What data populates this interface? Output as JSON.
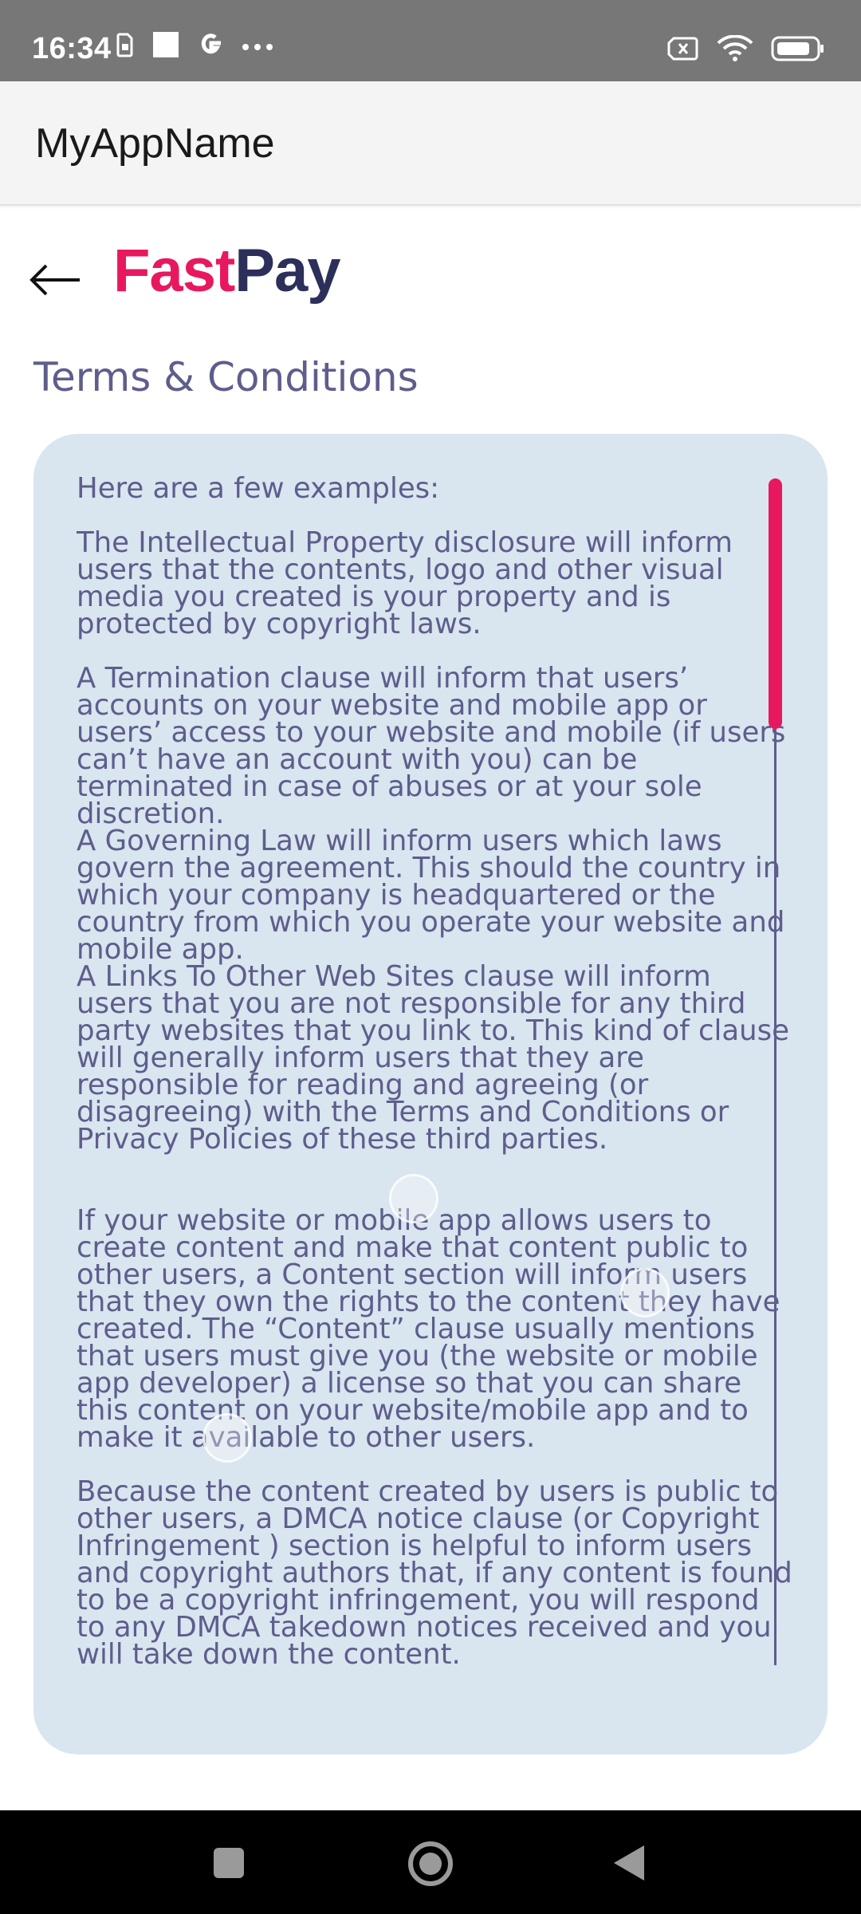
{
  "status_bar": {
    "time": "16:34",
    "left_icons": [
      "sim-icon",
      "notification-square-icon",
      "google-icon",
      "more-dots-icon"
    ],
    "right_icons": [
      "no-sim-icon",
      "wifi-icon",
      "battery-icon"
    ]
  },
  "app_bar": {
    "title": "MyAppName"
  },
  "header": {
    "back_icon": "arrow-left-icon",
    "logo_part1": "Fast",
    "logo_part2": "Pay",
    "logo_colors": {
      "fast": "#e8185f",
      "pay": "#2c2f5a"
    }
  },
  "page": {
    "title": "Terms & Conditions"
  },
  "terms": {
    "intro": "Here are a few examples:",
    "paragraphs": [
      "The Intellectual Property disclosure will inform users that the contents, logo and other visual media you created is your property and is protected by copyright laws.",
      "A Termination clause will inform that users’ accounts on your website and mobile app or users’ access to your website and mobile (if users can’t have an account with you) can be terminated in case of abuses or at your sole discretion.",
      "A Governing Law will inform users which laws govern the agreement. This should the country in which your company is headquartered or the country from which you operate your website and mobile app.",
      "A Links To Other Web Sites clause will inform users that you are not responsible for any third party websites that you link to. This kind of clause will generally inform users that they are responsible for reading and agreeing (or disagreeing) with the Terms and Conditions or Privacy Policies of these third parties.",
      "If your website or mobile app allows users to create content and make that content public to other users, a Content section will inform users that they own the rights to the content they have created. The “Content” clause usually mentions that users must give you (the website or mobile app developer) a license so that you can share this content on your website/mobile app and to make it available to other users.",
      "Because the content created by users is public to other users, a DMCA notice clause (or Copyright Infringement ) section is helpful to inform users and copyright authors that, if any content is found to be a copyright infringement, you will respond to any DMCA takedown notices received and you will take down the content."
    ]
  },
  "scrollbar": {
    "track_color": "#5e5d8c",
    "thumb_color": "#e8185f",
    "position_fraction": 0.0
  },
  "nav_bar": {
    "icons": [
      "recents-square-icon",
      "home-circle-icon",
      "back-triangle-icon"
    ]
  }
}
